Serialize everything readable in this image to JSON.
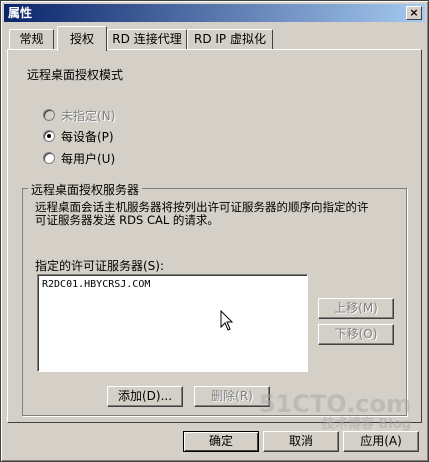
{
  "window": {
    "title": "属性",
    "close_glyph": "×"
  },
  "tabs": [
    {
      "label": "常规"
    },
    {
      "label": "授权"
    },
    {
      "label": "RD 连接代理"
    },
    {
      "label": "RD IP 虚拟化"
    }
  ],
  "licensing_mode": {
    "heading": "远程桌面授权模式",
    "options": [
      {
        "label": "未指定(N)",
        "selected": false,
        "enabled": false
      },
      {
        "label": "每设备(P)",
        "selected": true,
        "enabled": true
      },
      {
        "label": "每用户(U)",
        "selected": false,
        "enabled": true
      }
    ]
  },
  "license_servers": {
    "group_title": "远程桌面授权服务器",
    "description_line1": "远程桌面会话主机服务器将按列出许可证服务器的顺序向指定的许",
    "description_line2": "可证服务器发送 RDS CAL 的请求。",
    "list_label": "指定的许可证服务器(S):",
    "items": [
      "R2DC01.HBYCRSJ.COM"
    ],
    "move_up": "上移(M)",
    "move_down": "下移(O)",
    "add": "添加(D)...",
    "remove": "删除(R)"
  },
  "footer": {
    "ok": "确定",
    "cancel": "取消",
    "apply": "应用(A)"
  },
  "watermark": {
    "line1": "51CTO.com",
    "line2": "技术博客 Blog"
  }
}
